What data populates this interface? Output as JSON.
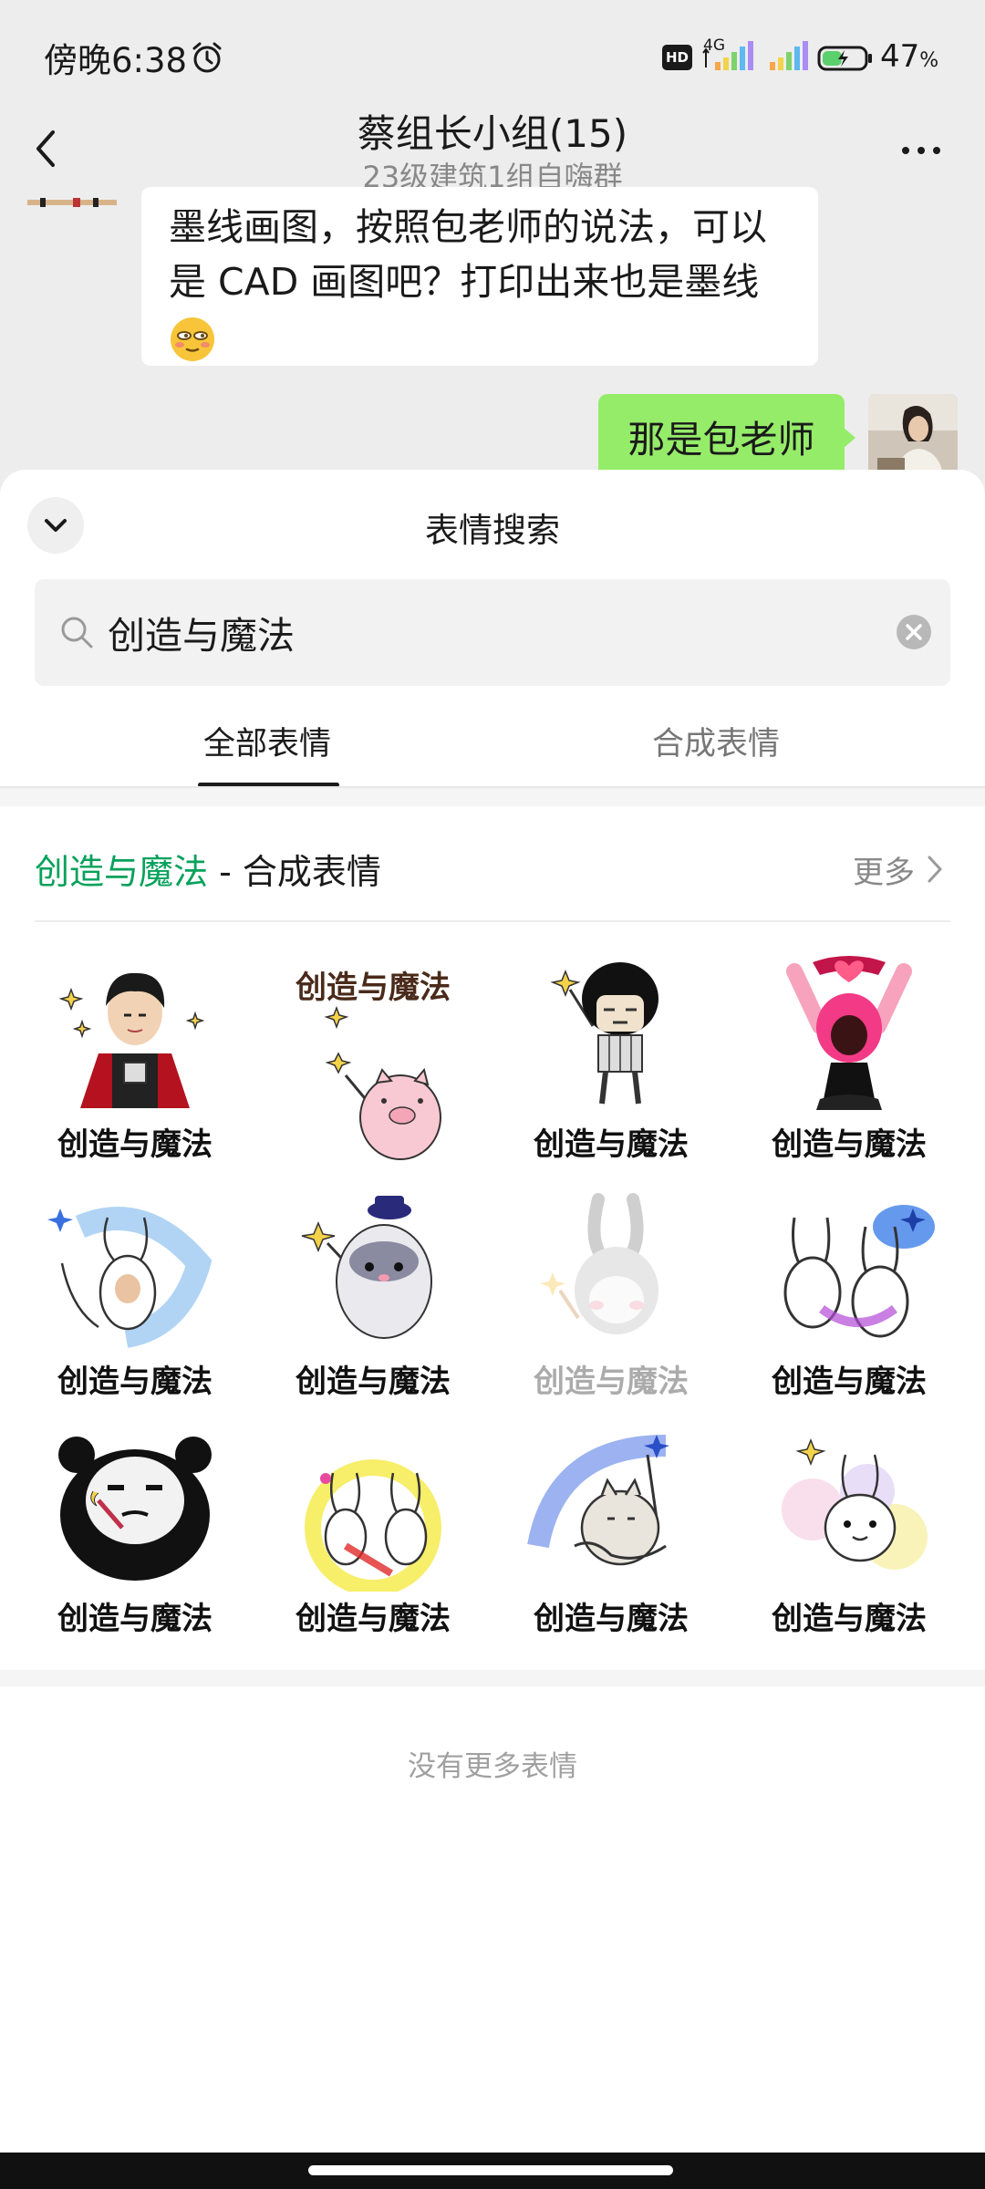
{
  "status_bar": {
    "time": "傍晚6:38",
    "hd": "HD",
    "network": "4G",
    "battery_percent": "47",
    "battery_unit": "%",
    "battery_level": 0.47
  },
  "chat": {
    "title": "蔡组长小组(15)",
    "subtitle": "23级建筑1组自嗨群",
    "incoming_message": "墨线画图，按照包老师的说法，可以是 CAD 画图吧？打印出来也是墨线",
    "outgoing_message": "那是包老师"
  },
  "sticker_search": {
    "title": "表情搜索",
    "query": "创造与魔法",
    "tabs": [
      "全部表情",
      "合成表情"
    ],
    "active_tab": "全部表情",
    "section_keyword": "创造与魔法",
    "section_suffix": " - 合成表情",
    "more_label": "更多",
    "stickers": [
      {
        "caption": "创造与魔法",
        "icon": "magician-boy-sticker"
      },
      {
        "caption": "创造与魔法",
        "icon": "pink-pig-wand-sticker"
      },
      {
        "caption": "创造与魔法",
        "icon": "mushroom-head-wand-sticker"
      },
      {
        "caption": "创造与魔法",
        "icon": "pink-hair-girl-sticker"
      },
      {
        "caption": "创造与魔法",
        "icon": "rabbit-blue-swirl-sticker"
      },
      {
        "caption": "创造与魔法",
        "icon": "hamster-hat-wand-sticker"
      },
      {
        "caption": "创造与魔法",
        "icon": "gray-bunny-wand-sticker"
      },
      {
        "caption": "创造与魔法",
        "icon": "two-rabbits-magic-sticker"
      },
      {
        "caption": "创造与魔法",
        "icon": "panda-wand-sticker"
      },
      {
        "caption": "创造与魔法",
        "icon": "rabbits-yellow-ring-sticker"
      },
      {
        "caption": "创造与魔法",
        "icon": "muscle-cat-stars-sticker"
      },
      {
        "caption": "创造与魔法",
        "icon": "bunny-sparkle-sticker"
      }
    ],
    "footer": "没有更多表情"
  },
  "colors": {
    "accent_green": "#07a15b",
    "outgoing_bubble": "#95ec69",
    "chat_background": "#ededed"
  }
}
